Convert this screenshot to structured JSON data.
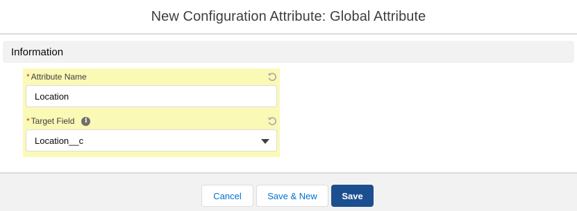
{
  "header": {
    "title": "New Configuration Attribute: Global Attribute"
  },
  "section": {
    "title": "Information"
  },
  "fields": {
    "attribute_name": {
      "required_marker": "*",
      "label": "Attribute Name",
      "value": "Location",
      "undo_icon": "undo-icon"
    },
    "target_field": {
      "required_marker": "*",
      "label": "Target Field",
      "info_icon": "info-icon",
      "info_glyph": "i",
      "value": "Location__c",
      "undo_icon": "undo-icon"
    }
  },
  "footer": {
    "cancel_label": "Cancel",
    "save_new_label": "Save & New",
    "save_label": "Save"
  },
  "colors": {
    "brand": "#1c4f8f",
    "link": "#0070d2",
    "highlight": "#fbf9b6",
    "required": "#c23934"
  }
}
